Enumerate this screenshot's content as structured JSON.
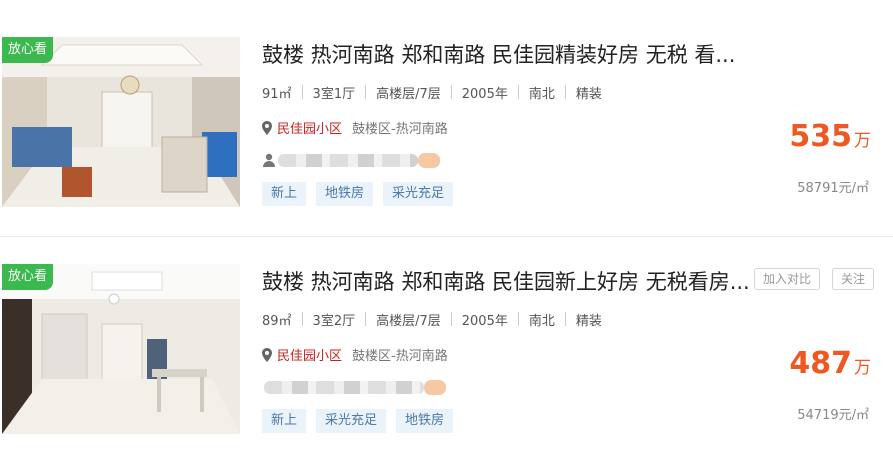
{
  "listings": [
    {
      "badge": "放心看",
      "title": "鼓楼 热河南路 郑和南路 民佳园精装好房 无税 看...",
      "area": "91㎡",
      "layout": "3室1厅",
      "floor": "高楼层/7层",
      "year": "2005年",
      "orientation": "南北",
      "decoration": "精装",
      "community": "民佳园小区",
      "district": "鼓楼区-热河南路",
      "tags": [
        "新上",
        "地铁房",
        "采光充足"
      ],
      "price": "535",
      "price_unit": "万",
      "unit_price": "58791元/㎡"
    },
    {
      "badge": "放心看",
      "title": "鼓楼 热河南路 郑和南路 民佳园新上好房 无税看房...",
      "area": "89㎡",
      "layout": "3室2厅",
      "floor": "高楼层/7层",
      "year": "2005年",
      "orientation": "南北",
      "decoration": "精装",
      "community": "民佳园小区",
      "district": "鼓楼区-热河南路",
      "tags": [
        "新上",
        "采光充足",
        "地铁房"
      ],
      "price": "487",
      "price_unit": "万",
      "unit_price": "54719元/㎡",
      "compare_label": "加入对比",
      "follow_label": "关注"
    }
  ],
  "icons": {
    "location": "location-pin-icon",
    "agent": "person-icon"
  },
  "colors": {
    "badge": "#3bb84e",
    "price": "#f05822",
    "community": "#c8201d",
    "tag_bg": "#eaf2fa",
    "tag_text": "#4a7aa8"
  }
}
